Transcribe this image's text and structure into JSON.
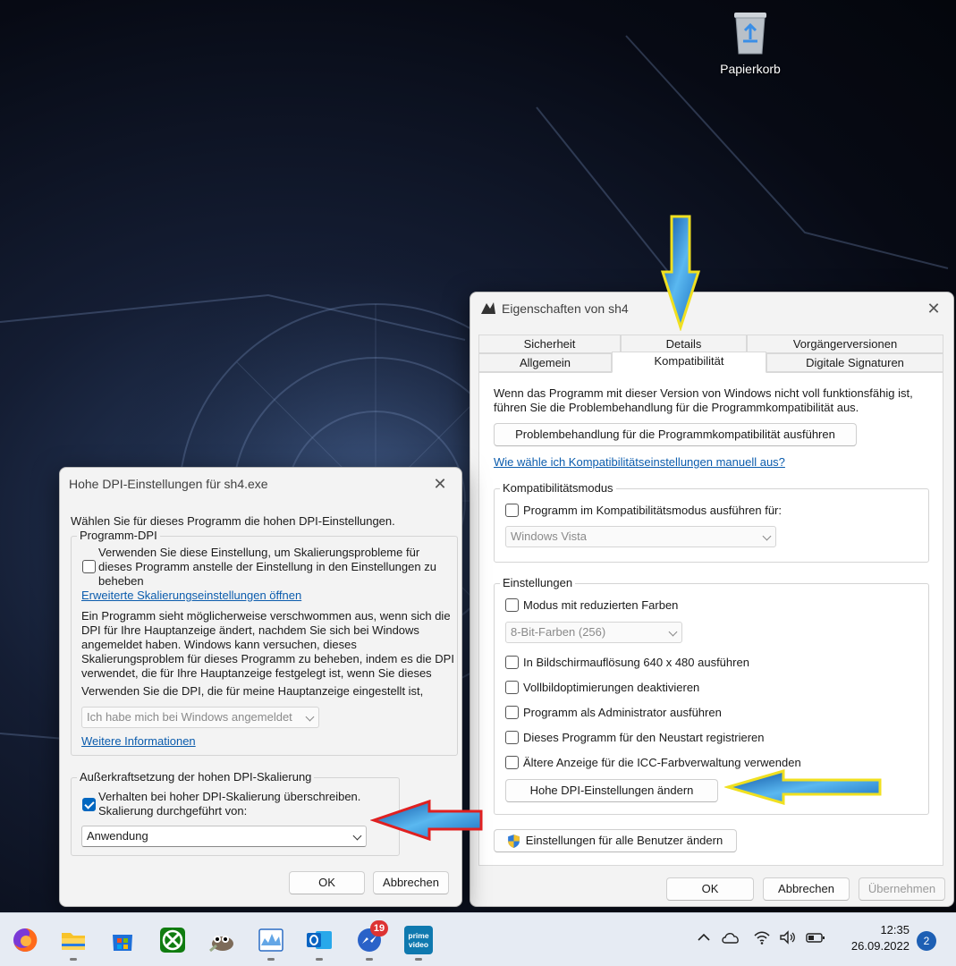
{
  "desktop": {
    "recycle_bin_label": "Papierkorb"
  },
  "props_window": {
    "title": "Eigenschaften von sh4",
    "tabs_row1": [
      "Sicherheit",
      "Details",
      "Vorgängerversionen"
    ],
    "tabs_row2": [
      "Allgemein",
      "Kompatibilität",
      "Digitale Signaturen"
    ],
    "active_tab": "Kompatibilität",
    "intro_line1": "Wenn das Programm mit dieser Version von Windows nicht voll funktionsfähig ist,",
    "intro_line2": "führen Sie die Problembehandlung für die Programmkompatibilität aus.",
    "troubleshoot_button": "Problembehandlung für die Programmkompatibilität ausführen",
    "manual_link": "Wie wähle ich Kompatibilitätseinstellungen manuell aus?",
    "compat_mode": {
      "group_label": "Kompatibilitätsmodus",
      "checkbox_label": "Programm im Kompatibilitätsmodus ausführen für:",
      "checked": false,
      "select_value": "Windows Vista"
    },
    "settings": {
      "group_label": "Einstellungen",
      "reduced_colors_label": "Modus mit reduzierten Farben",
      "color_select_value": "8-Bit-Farben (256)",
      "options": [
        "In Bildschirmauflösung 640 x 480 ausführen",
        "Vollbildoptimierungen deaktivieren",
        "Programm als Administrator ausführen",
        "Dieses Programm für den Neustart registrieren",
        "Ältere Anzeige für die ICC-Farbverwaltung verwenden"
      ],
      "dpi_button": "Hohe DPI-Einstellungen ändern"
    },
    "all_users_button": "Einstellungen für alle Benutzer ändern",
    "ok": "OK",
    "cancel": "Abbrechen",
    "apply": "Übernehmen"
  },
  "dpi_window": {
    "title": "Hohe DPI-Einstellungen für sh4.exe",
    "intro": "Wählen Sie für dieses Programm die hohen DPI-Einstellungen.",
    "program_dpi": {
      "group_label": "Programm-DPI",
      "checkbox_line1": "Verwenden Sie diese Einstellung, um Skalierungsprobleme für",
      "checkbox_line2": "dieses Programm anstelle der Einstellung in den Einstellungen zu",
      "checkbox_line3": "beheben",
      "checked": false,
      "link": "Erweiterte Skalierungseinstellungen öffnen",
      "desc_line1": "Ein Programm sieht möglicherweise verschwommen aus, wenn sich die",
      "desc_line2": "DPI für Ihre Hauptanzeige ändert, nachdem Sie sich bei Windows",
      "desc_line3": "angemeldet haben. Windows kann versuchen, dieses",
      "desc_line4": "Skalierungsproblem für dieses Programm zu beheben, indem es die DPI",
      "desc_line5": "verwendet, die für Ihre Hauptanzeige festgelegt ist, wenn Sie dieses",
      "use_dpi_label": "Verwenden Sie die DPI, die für meine Hauptanzeige eingestellt ist,",
      "select_value": "Ich habe mich bei Windows angemeldet",
      "more_info_link": "Weitere Informationen"
    },
    "override": {
      "group_label": "Außerkraftsetzung der hohen DPI-Skalierung",
      "checkbox_line1": "Verhalten bei hoher DPI-Skalierung überschreiben.",
      "checkbox_line2": "Skalierung durchgeführt von:",
      "checked": true,
      "select_value": "Anwendung"
    },
    "ok": "OK",
    "cancel": "Abbrechen"
  },
  "taskbar": {
    "apps": [
      "firefox-icon",
      "file-explorer-icon",
      "microsoft-store-icon",
      "xbox-icon",
      "gimp-icon",
      "system-monitor-icon",
      "outlook-icon",
      "messenger-icon",
      "prime-video-icon"
    ],
    "messenger_badge": "19",
    "prime_label_1": "prime",
    "prime_label_2": "video",
    "time": "12:35",
    "date": "26.09.2022",
    "notification_count": "2"
  }
}
